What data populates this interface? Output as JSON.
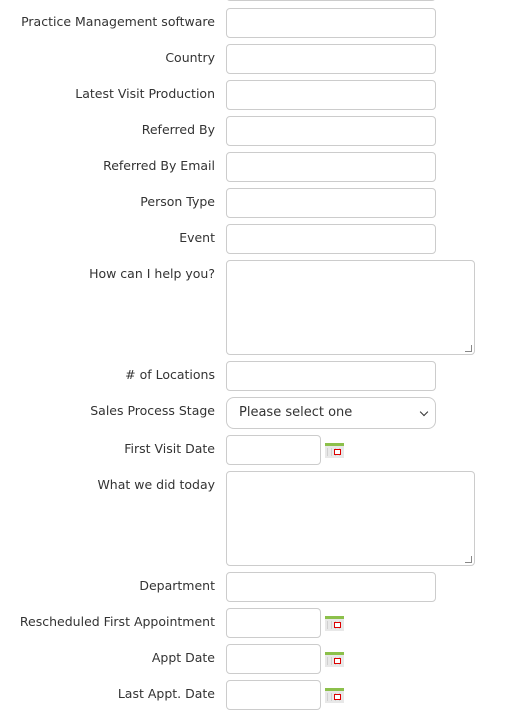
{
  "fields": [
    {
      "label": "Practice Management software",
      "type": "text"
    },
    {
      "label": "Country",
      "type": "text"
    },
    {
      "label": "Latest Visit Production",
      "type": "text"
    },
    {
      "label": "Referred By",
      "type": "text"
    },
    {
      "label": "Referred By Email",
      "type": "text"
    },
    {
      "label": "Person Type",
      "type": "text"
    },
    {
      "label": "Event",
      "type": "text"
    },
    {
      "label": "How can I help you?",
      "type": "textarea"
    },
    {
      "label": "# of Locations",
      "type": "text"
    },
    {
      "label": "Sales Process Stage",
      "type": "select",
      "value": "Please select one"
    },
    {
      "label": "First Visit Date",
      "type": "date",
      "icon": "calendar-icon"
    },
    {
      "label": "What we did today",
      "type": "textarea"
    },
    {
      "label": "Department",
      "type": "text"
    },
    {
      "label": "Rescheduled First Appointment",
      "type": "date",
      "icon": "calendar-icon"
    },
    {
      "label": "Appt Date",
      "type": "date",
      "icon": "calendar-icon"
    },
    {
      "label": "Last Appt. Date",
      "type": "date",
      "icon": "calendar-icon"
    }
  ]
}
